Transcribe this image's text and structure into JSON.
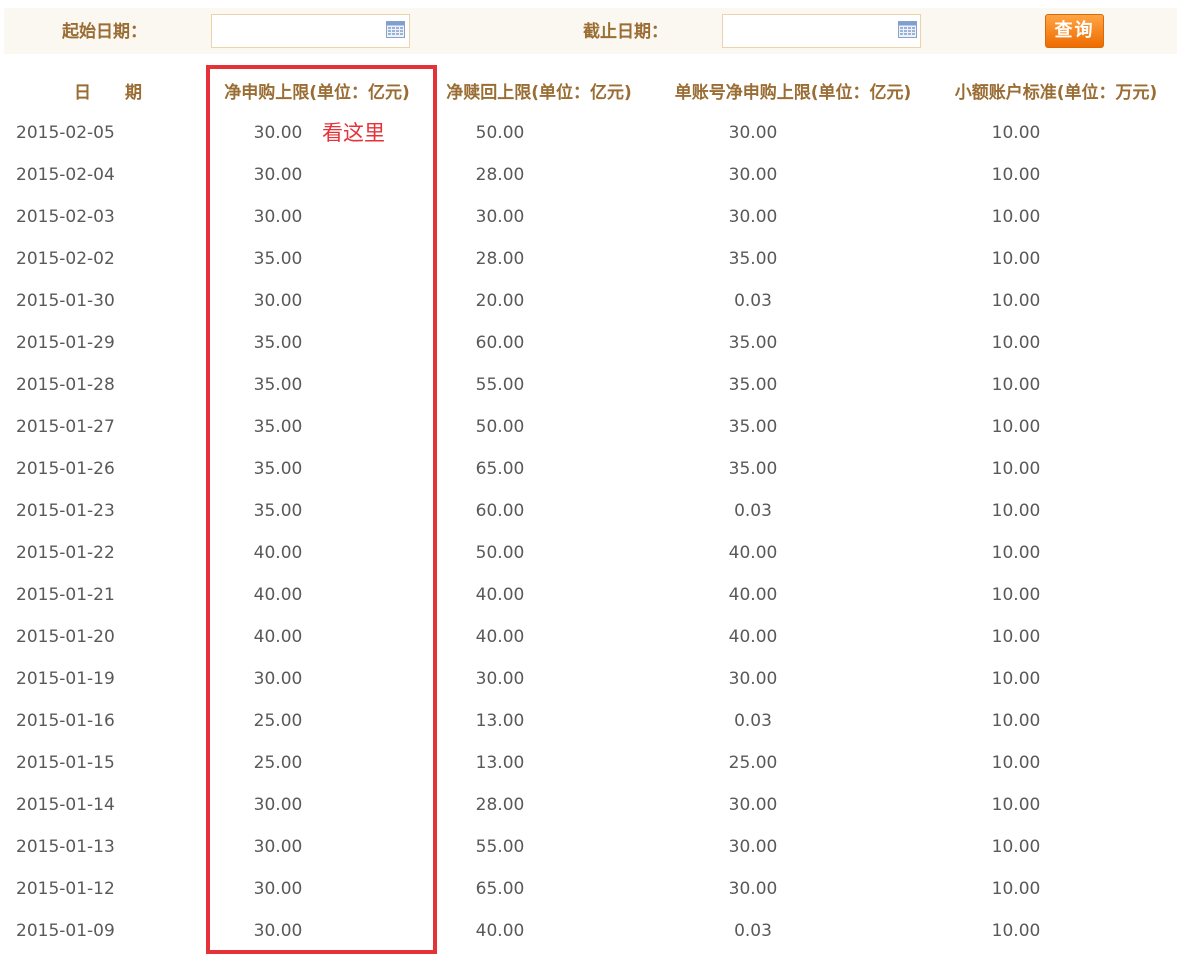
{
  "filter": {
    "start_label": "起始日期：",
    "start_value": "",
    "end_label": "截止日期：",
    "end_value": "",
    "query_button": "查询"
  },
  "table": {
    "headers": [
      "日　　期",
      "净申购上限(单位：亿元)",
      "净赎回上限(单位：亿元)",
      "单账号净申购上限(单位：亿元)",
      "小额账户标准(单位：万元)"
    ],
    "rows": [
      [
        "2015-02-05",
        "30.00",
        "50.00",
        "30.00",
        "10.00"
      ],
      [
        "2015-02-04",
        "30.00",
        "28.00",
        "30.00",
        "10.00"
      ],
      [
        "2015-02-03",
        "30.00",
        "30.00",
        "30.00",
        "10.00"
      ],
      [
        "2015-02-02",
        "35.00",
        "28.00",
        "35.00",
        "10.00"
      ],
      [
        "2015-01-30",
        "30.00",
        "20.00",
        "0.03",
        "10.00"
      ],
      [
        "2015-01-29",
        "35.00",
        "60.00",
        "35.00",
        "10.00"
      ],
      [
        "2015-01-28",
        "35.00",
        "55.00",
        "35.00",
        "10.00"
      ],
      [
        "2015-01-27",
        "35.00",
        "50.00",
        "35.00",
        "10.00"
      ],
      [
        "2015-01-26",
        "35.00",
        "65.00",
        "35.00",
        "10.00"
      ],
      [
        "2015-01-23",
        "35.00",
        "60.00",
        "0.03",
        "10.00"
      ],
      [
        "2015-01-22",
        "40.00",
        "50.00",
        "40.00",
        "10.00"
      ],
      [
        "2015-01-21",
        "40.00",
        "40.00",
        "40.00",
        "10.00"
      ],
      [
        "2015-01-20",
        "40.00",
        "40.00",
        "40.00",
        "10.00"
      ],
      [
        "2015-01-19",
        "30.00",
        "30.00",
        "30.00",
        "10.00"
      ],
      [
        "2015-01-16",
        "25.00",
        "13.00",
        "0.03",
        "10.00"
      ],
      [
        "2015-01-15",
        "25.00",
        "13.00",
        "25.00",
        "10.00"
      ],
      [
        "2015-01-14",
        "30.00",
        "28.00",
        "30.00",
        "10.00"
      ],
      [
        "2015-01-13",
        "30.00",
        "55.00",
        "30.00",
        "10.00"
      ],
      [
        "2015-01-12",
        "30.00",
        "65.00",
        "30.00",
        "10.00"
      ],
      [
        "2015-01-09",
        "30.00",
        "40.00",
        "0.03",
        "10.00"
      ]
    ]
  },
  "annotation": {
    "text": "看这里",
    "color": "#e53238"
  },
  "icons": {
    "start_calendar": "calendar-icon",
    "end_calendar": "calendar-icon"
  },
  "colors": {
    "label": "#9a6d34",
    "button": "#f47a0c",
    "highlight": "#e53238",
    "input_border": "#ecd3a9"
  }
}
